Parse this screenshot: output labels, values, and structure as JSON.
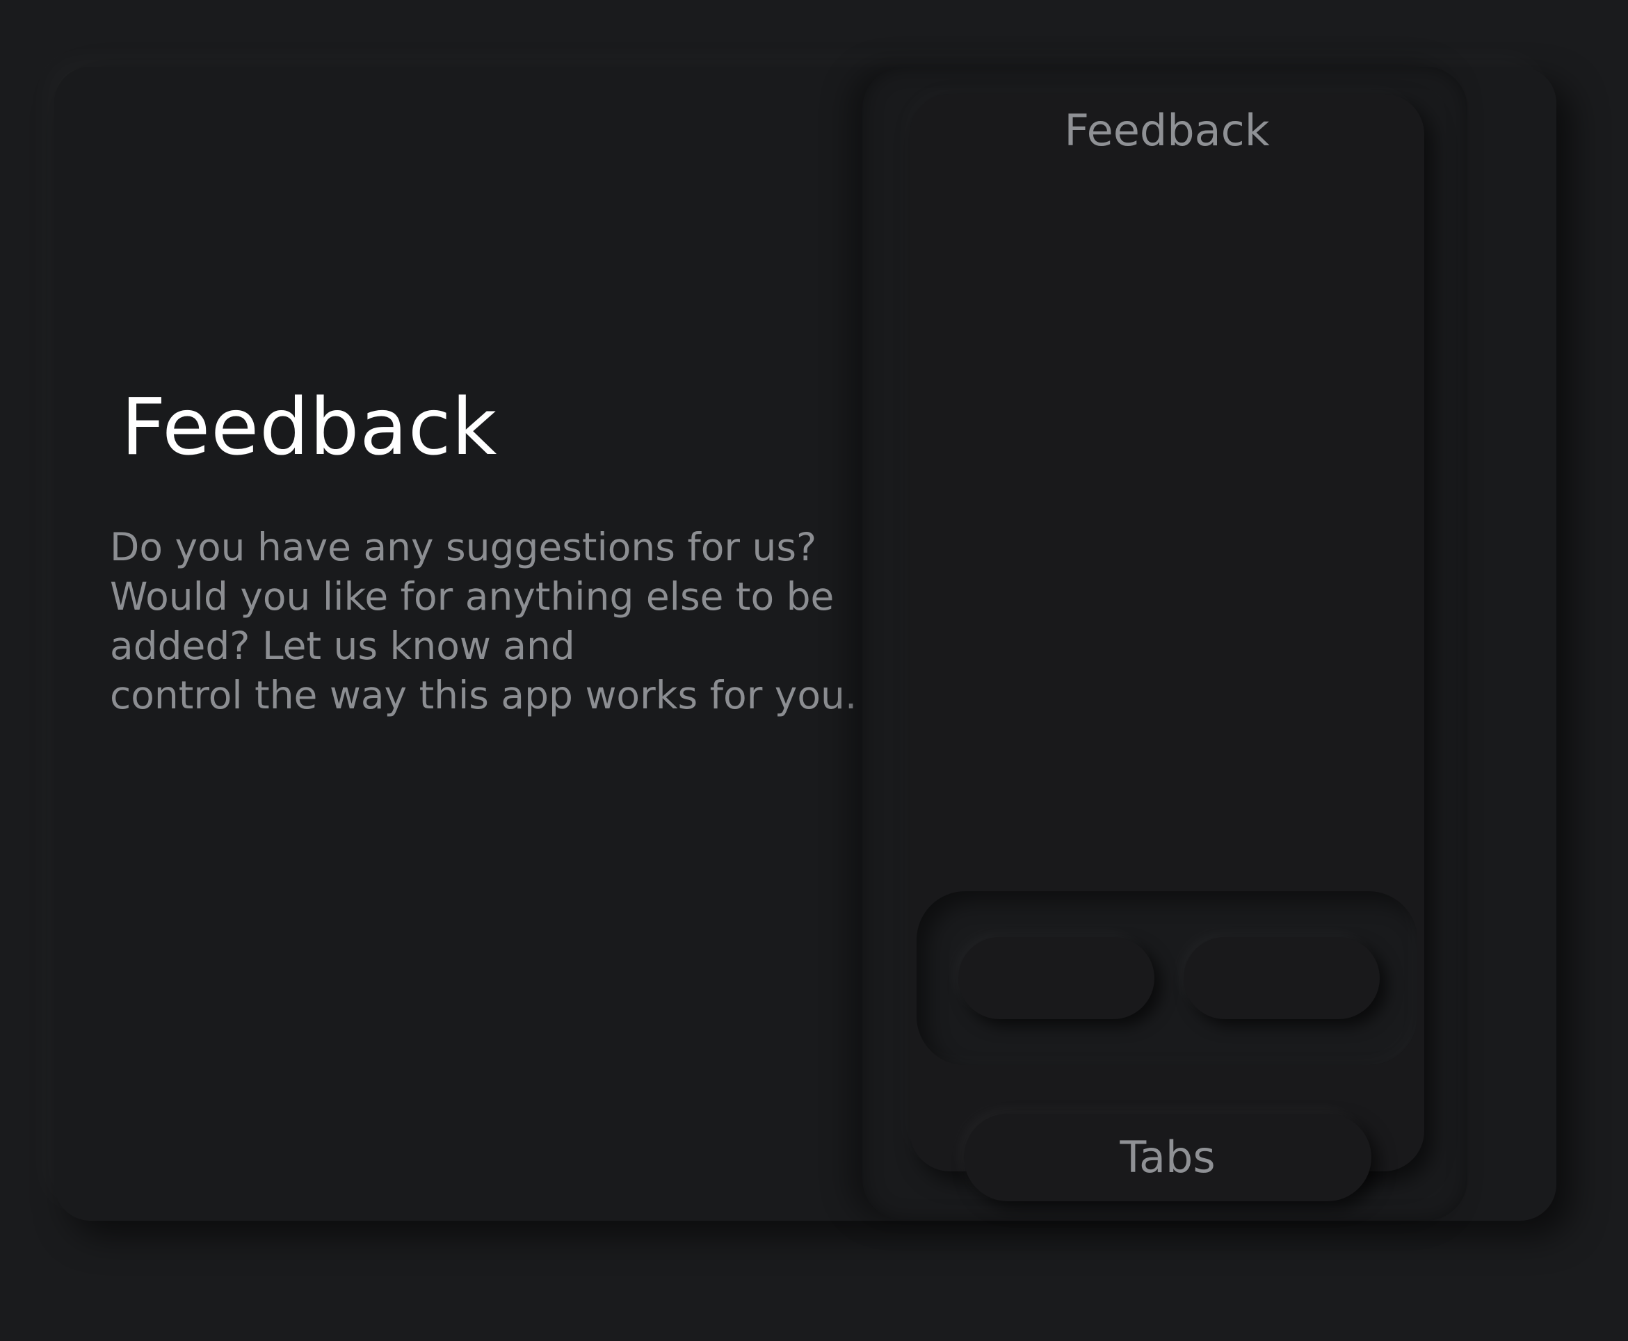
{
  "intro": {
    "title": "Feedback",
    "description": "Do you have any suggestions for us?\nWould you like for anything else to be\nadded? Let us know and\ncontrol the way this app works for you."
  },
  "preview": {
    "screen_title": "Feedback",
    "tabs_label": "Tabs"
  },
  "colors": {
    "background": "#1a1b1d",
    "title_text": "#ffffff",
    "body_text": "#8c8e92"
  }
}
